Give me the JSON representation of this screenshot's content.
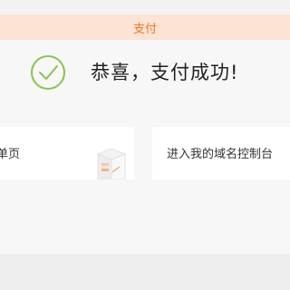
{
  "header": {
    "title": "支付"
  },
  "result": {
    "message": "恭喜，支付成功!"
  },
  "actions": {
    "left_card_label": "单页",
    "right_card_label": "进入我的域名控制台"
  },
  "icons": {
    "success": "check-circle-icon",
    "illustration": "box-icon"
  },
  "colors": {
    "header_bg": "#fde3d3",
    "header_text": "#f0732a",
    "success_green": "#8bc34a"
  }
}
